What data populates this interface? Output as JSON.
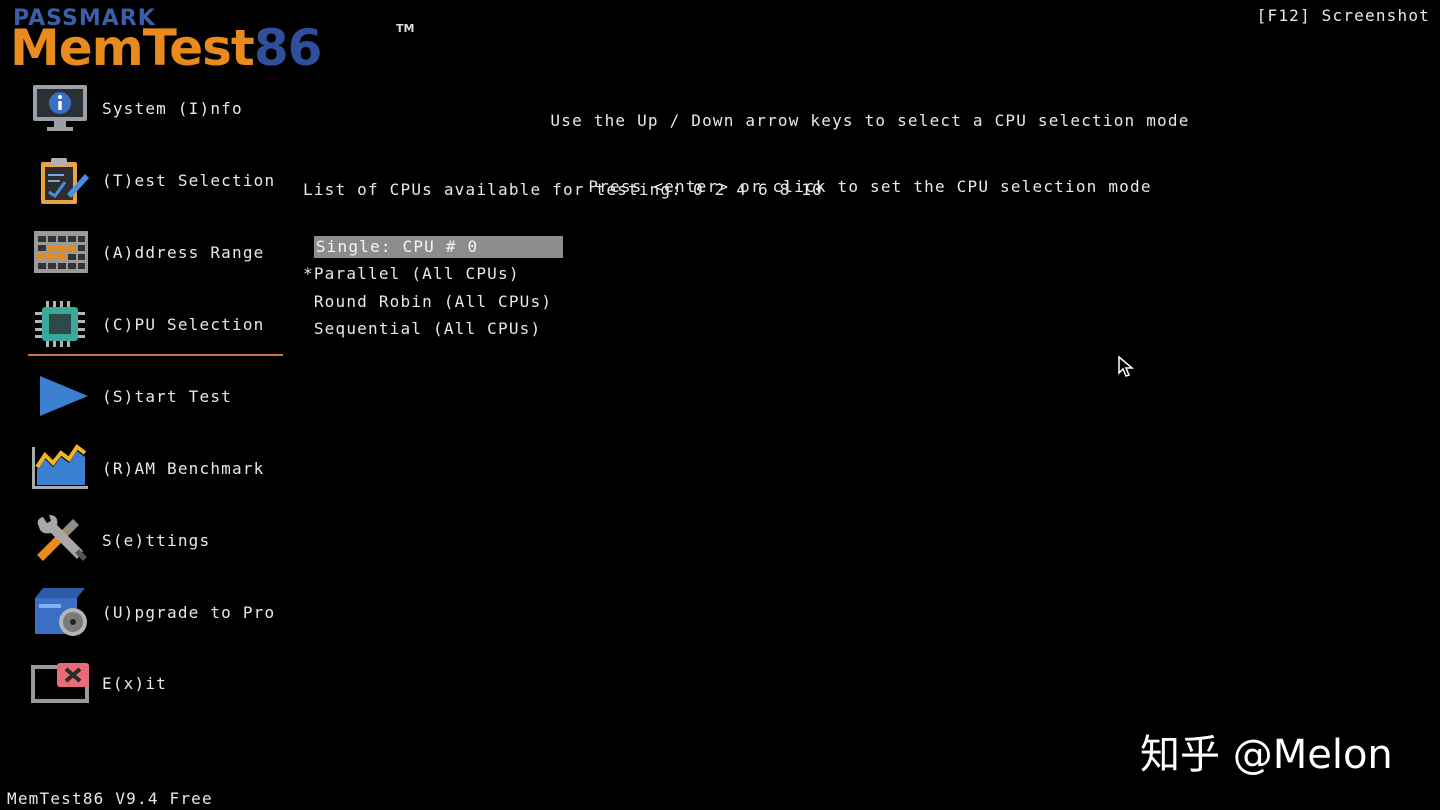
{
  "logo": {
    "brand_small": "PASSMARK",
    "brand_main_part1": "MemTest",
    "brand_main_part2": "86",
    "tm": "TM"
  },
  "header": {
    "f12_label": "[F12] Screenshot",
    "instruction_line1": "Use the Up / Down arrow keys to select a CPU selection mode",
    "instruction_line2": "Press <enter> or click to set the CPU selection mode"
  },
  "sidebar": {
    "items": [
      {
        "label": "System (I)nfo",
        "icon": "system-info-icon"
      },
      {
        "label": "(T)est Selection",
        "icon": "test-selection-icon"
      },
      {
        "label": "(A)ddress Range",
        "icon": "address-range-icon"
      },
      {
        "label": "(C)PU Selection",
        "icon": "cpu-icon"
      },
      {
        "label": "(S)tart Test",
        "icon": "play-icon"
      },
      {
        "label": "(R)AM Benchmark",
        "icon": "benchmark-chart-icon"
      },
      {
        "label": "S(e)ttings",
        "icon": "wrench-screwdriver-icon"
      },
      {
        "label": "(U)pgrade to Pro",
        "icon": "upgrade-box-icon"
      },
      {
        "label": "E(x)it",
        "icon": "exit-icon"
      }
    ],
    "active": "(C)PU Selection"
  },
  "main": {
    "cpu_list_label": "List of CPUs available for testing: 0 2 4 6 8 10",
    "options": [
      {
        "label": "Single: CPU # 0",
        "marker": " ",
        "highlighted": true
      },
      {
        "label": "Parallel (All CPUs)",
        "marker": "*",
        "highlighted": false
      },
      {
        "label": "Round Robin (All CPUs)",
        "marker": " ",
        "highlighted": false
      },
      {
        "label": "Sequential (All CPUs)",
        "marker": " ",
        "highlighted": false
      }
    ]
  },
  "footer": {
    "version": "MemTest86 V9.4 Free"
  },
  "watermark": "知乎 @Melon",
  "colors": {
    "background": "#000000",
    "text": "#e8e8e8",
    "highlight": "#8c8c8c",
    "separator": "#c8743a",
    "logo_orange": "#e88a1e",
    "logo_blue": "#2f4f9a"
  }
}
